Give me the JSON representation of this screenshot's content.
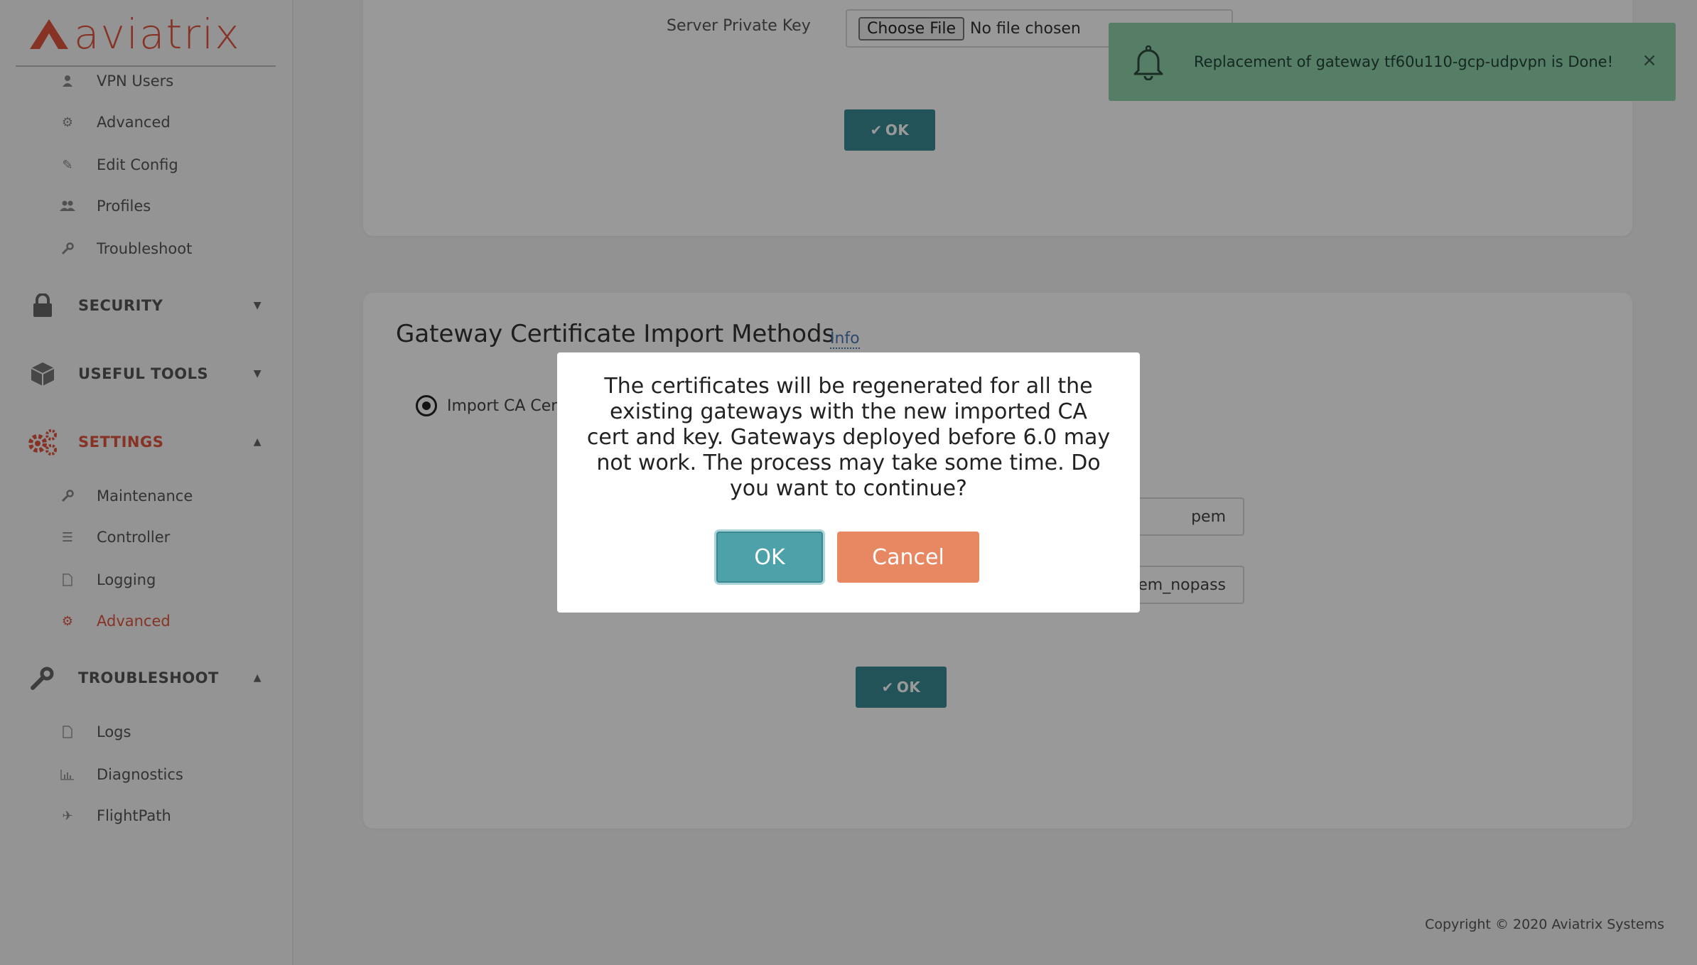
{
  "logo": {
    "text": "aviatrix"
  },
  "sidebar": {
    "top_items": [
      {
        "label": "VPN Users",
        "icon": "user-icon"
      },
      {
        "label": "Advanced",
        "icon": "gear-icon"
      },
      {
        "label": "Edit Config",
        "icon": "edit-icon"
      },
      {
        "label": "Profiles",
        "icon": "users-icon"
      },
      {
        "label": "Troubleshoot",
        "icon": "wrench-icon"
      }
    ],
    "sections": [
      {
        "label": "SECURITY",
        "icon": "lock-icon",
        "caret": "▼"
      },
      {
        "label": "USEFUL TOOLS",
        "icon": "cube-icon",
        "caret": "▼"
      },
      {
        "label": "SETTINGS",
        "icon": "gears-icon",
        "caret": "▲"
      },
      {
        "label": "TROUBLESHOOT",
        "icon": "wrench-icon",
        "caret": "▲"
      }
    ],
    "settings_items": [
      {
        "label": "Maintenance",
        "icon": "wrench-icon"
      },
      {
        "label": "Controller",
        "icon": "list-icon"
      },
      {
        "label": "Logging",
        "icon": "file-icon"
      },
      {
        "label": "Advanced",
        "icon": "gear-icon",
        "active": true
      }
    ],
    "troubleshoot_items": [
      {
        "label": "Logs",
        "icon": "file-icon"
      },
      {
        "label": "Diagnostics",
        "icon": "bar-chart-icon"
      },
      {
        "label": "FlightPath",
        "icon": "plane-icon"
      }
    ]
  },
  "top_card": {
    "server_key_label": "Server Private Key",
    "choose_file_label": "Choose File",
    "no_file_text": "No file chosen",
    "ok_label": "OK"
  },
  "bottom_card": {
    "title": "Gateway Certificate Import Methods",
    "info_link": "Info",
    "radio_label": "Import CA Cer",
    "input1_value": "pem",
    "input2_value": "em_nopass",
    "ok_label": "OK"
  },
  "toast": {
    "message": "Replacement of gateway tf60u110-gcp-udpvpn is Done!",
    "close": "×"
  },
  "modal": {
    "message": "The certificates will be regenerated for all the existing gateways with the new imported CA cert and key. Gateways deployed before 6.0 may not work. The process may take some time. Do you want to continue?",
    "ok_label": "OK",
    "cancel_label": "Cancel"
  },
  "footer": {
    "copyright": "Copyright © 2020 Aviatrix Systems"
  },
  "colors": {
    "brand": "#e0563f",
    "teal": "#3a8a93",
    "toast_bg": "#8fd3ab",
    "cancel": "#e88862"
  }
}
